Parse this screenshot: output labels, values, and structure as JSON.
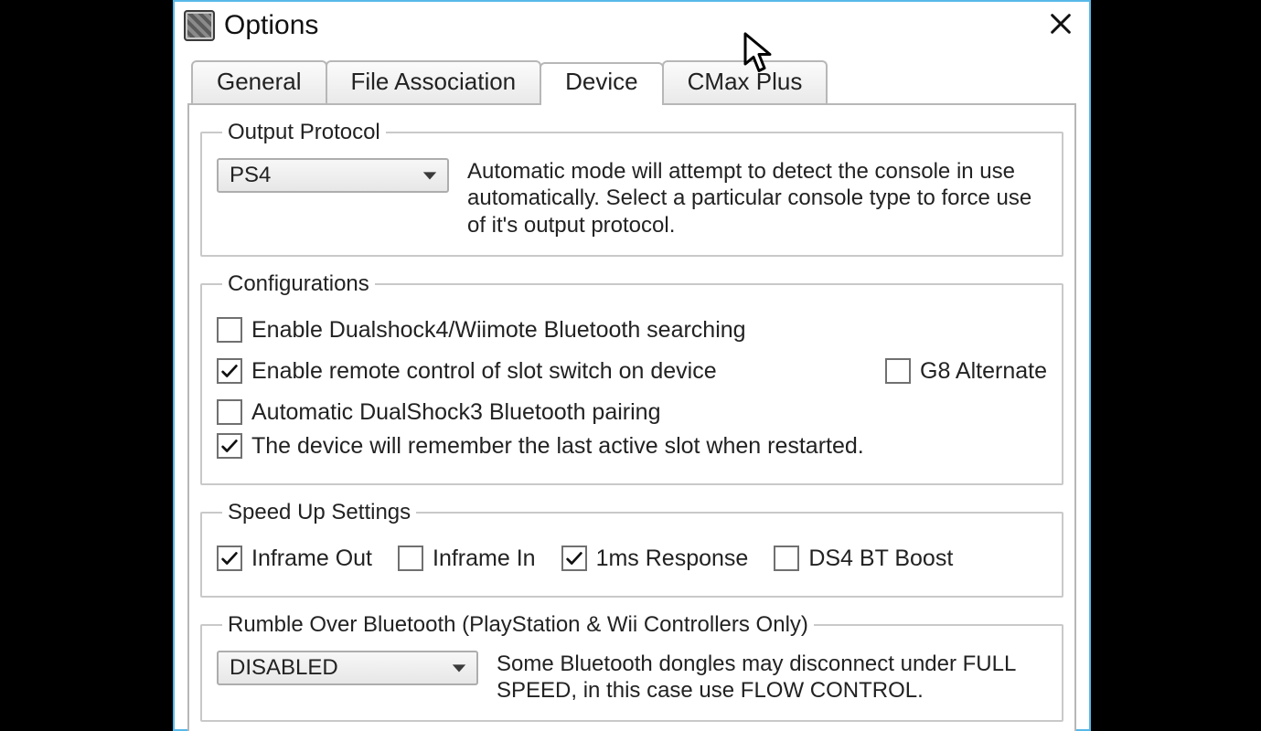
{
  "window": {
    "title": "Options"
  },
  "tabs": [
    "General",
    "File Association",
    "Device",
    "CMax Plus"
  ],
  "active_tab_index": 2,
  "output_protocol": {
    "legend": "Output Protocol",
    "selected": "PS4",
    "description": "Automatic mode will attempt to detect the console in use automatically. Select a particular console type to force use of it's output protocol."
  },
  "configurations": {
    "legend": "Configurations",
    "items": [
      {
        "label": "Enable Dualshock4/Wiimote Bluetooth searching",
        "checked": false
      },
      {
        "label": "Enable remote control of slot switch on device",
        "checked": true
      },
      {
        "label": "Automatic DualShock3 Bluetooth pairing",
        "checked": false
      },
      {
        "label": "The device will remember the last active slot when restarted.",
        "checked": true
      }
    ],
    "g8_alternate": {
      "label": "G8 Alternate",
      "checked": false
    }
  },
  "speed_up": {
    "legend": "Speed Up Settings",
    "items": [
      {
        "label": "Inframe Out",
        "checked": true
      },
      {
        "label": "Inframe In",
        "checked": false
      },
      {
        "label": "1ms Response",
        "checked": true
      },
      {
        "label": "DS4 BT Boost",
        "checked": false
      }
    ]
  },
  "rumble": {
    "legend": "Rumble Over Bluetooth (PlayStation & Wii Controllers Only)",
    "selected": "DISABLED",
    "description": "Some Bluetooth dongles may disconnect under FULL SPEED, in this case use FLOW CONTROL."
  }
}
